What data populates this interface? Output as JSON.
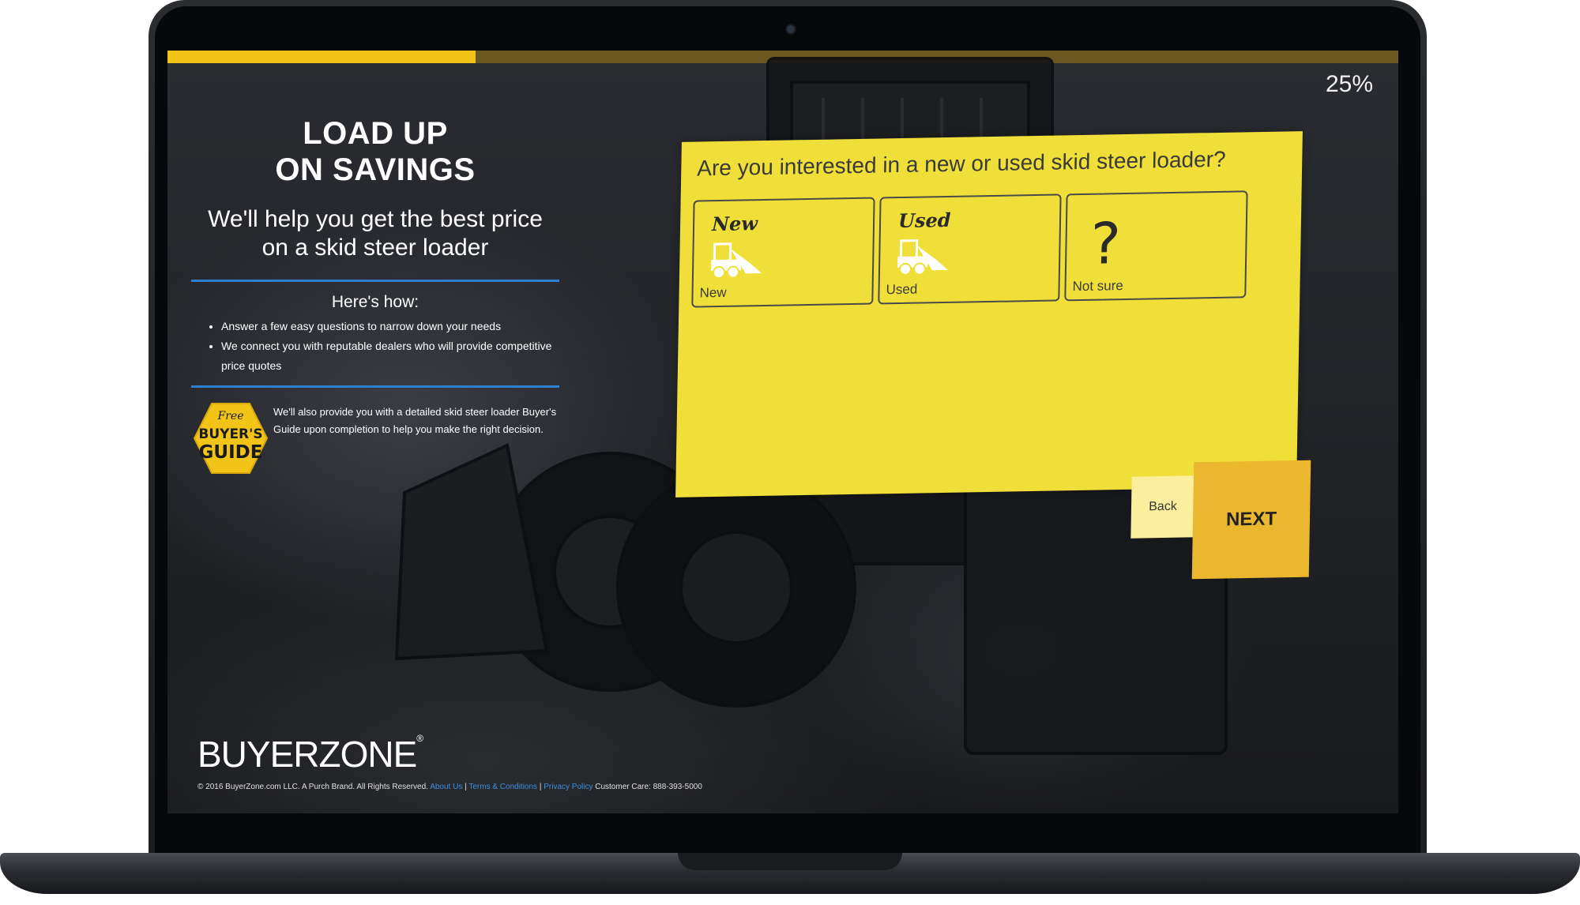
{
  "progress": {
    "percent_label": "25%",
    "fraction": 0.25
  },
  "left_panel": {
    "headline_line1": "LOAD UP",
    "headline_line2": "ON SAVINGS",
    "subheading_line1": "We'll help you get the best price",
    "subheading_line2": "on a skid steer loader",
    "how_title": "Here's how:",
    "bullets": [
      "Answer a few easy questions to narrow down your needs",
      "We connect you with reputable dealers who will provide competitive price quotes"
    ],
    "badge": {
      "line1": "Free",
      "line2": "BUYER'S",
      "line3": "GUIDE"
    },
    "guide_text": "We'll also provide you with a detailed skid steer loader Buyer's Guide upon completion to help you make the right decision."
  },
  "question": {
    "text": "Are you interested in a new or used skid steer loader?",
    "options": [
      {
        "title": "New",
        "label": "New",
        "icon": "skid-steer-icon"
      },
      {
        "title": "Used",
        "label": "Used",
        "icon": "skid-steer-icon"
      },
      {
        "title": "",
        "label": "Not sure",
        "icon": "question-mark-icon"
      }
    ]
  },
  "buttons": {
    "back": "Back",
    "next": "NEXT"
  },
  "brand": {
    "logo": "BUYERZONE",
    "reg": "®"
  },
  "footer": {
    "copyright": "© 2016 BuyerZone.com LLC. A Purch Brand. All Rights Reserved.",
    "about": "About Us",
    "terms": "Terms & Conditions",
    "privacy": "Privacy Policy",
    "care": "Customer Care: 888-393-5000",
    "sep": "|"
  },
  "colors": {
    "accent_yellow": "#f2c418",
    "card_yellow": "#f0df38",
    "link_blue": "#3d90e0"
  }
}
